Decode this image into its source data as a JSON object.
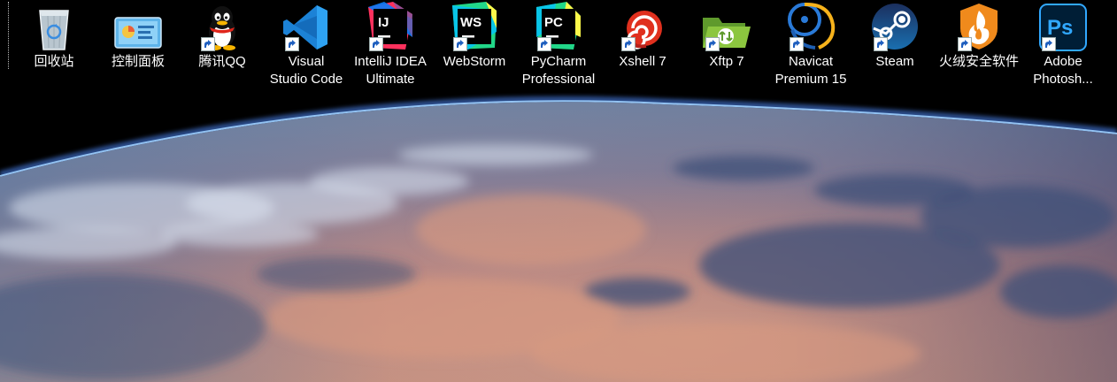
{
  "desktop": {
    "icons": [
      {
        "label": "回收站",
        "icon": "recycle-bin-icon",
        "shortcut": false
      },
      {
        "label": "控制面板",
        "icon": "control-panel-icon",
        "shortcut": false
      },
      {
        "label": "腾讯QQ",
        "icon": "qq-penguin-icon",
        "shortcut": true
      },
      {
        "label": "Visual\nStudio Code",
        "icon": "vscode-icon",
        "shortcut": true
      },
      {
        "label": "IntelliJ IDEA\nUltimate",
        "icon": "intellij-idea-icon",
        "shortcut": true
      },
      {
        "label": "WebStorm",
        "icon": "webstorm-icon",
        "shortcut": true
      },
      {
        "label": "PyCharm\nProfessional",
        "icon": "pycharm-icon",
        "shortcut": true
      },
      {
        "label": "Xshell 7",
        "icon": "xshell-icon",
        "shortcut": true
      },
      {
        "label": "Xftp 7",
        "icon": "xftp-icon",
        "shortcut": true
      },
      {
        "label": "Navicat\nPremium 15",
        "icon": "navicat-icon",
        "shortcut": true
      },
      {
        "label": "Steam",
        "icon": "steam-icon",
        "shortcut": true
      },
      {
        "label": "火绒安全软件",
        "icon": "huorong-security-icon",
        "shortcut": true
      },
      {
        "label": "Adobe\nPhotosh...",
        "icon": "photoshop-icon",
        "shortcut": true
      }
    ],
    "icon_badges": {
      "intellij": "IJ",
      "webstorm": "WS",
      "pycharm": "PC",
      "photoshop": "Ps"
    },
    "wallpaper": "earth-from-orbit"
  }
}
